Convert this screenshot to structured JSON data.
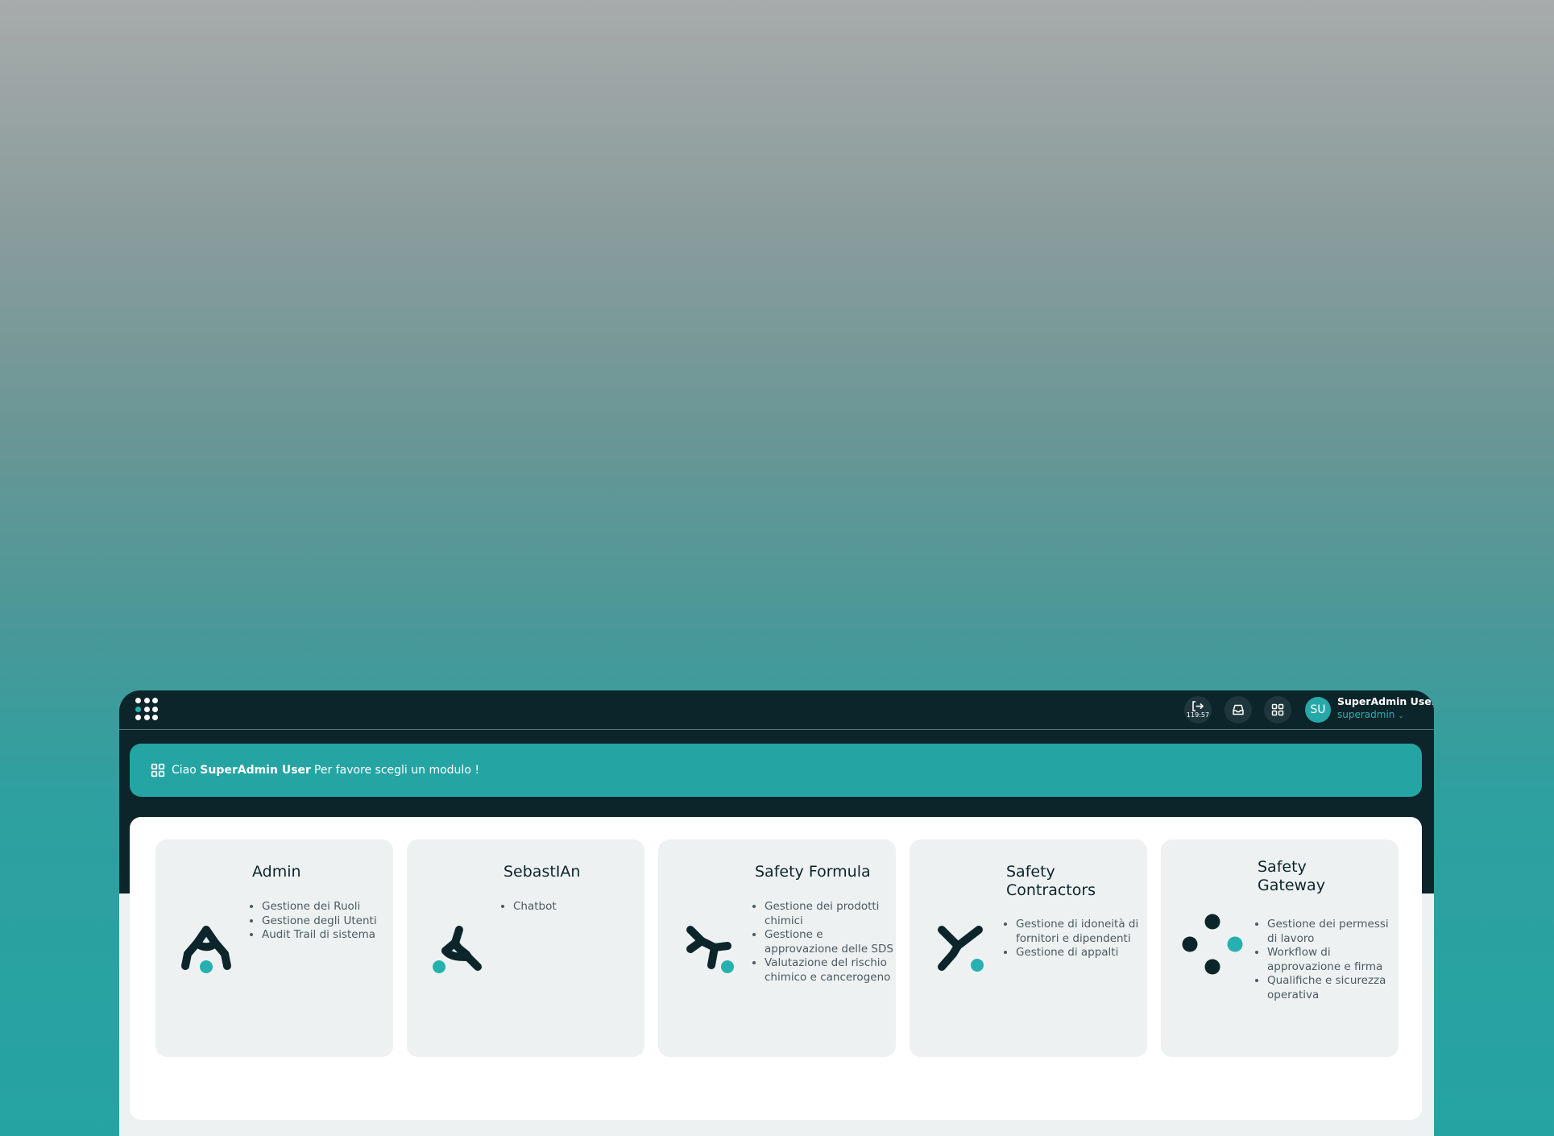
{
  "topbar": {
    "session_timer": "119:57",
    "user_initials": "SU",
    "user_name": "SuperAdmin User",
    "user_role": "superadmin",
    "role_chevron": "⌄"
  },
  "welcome": {
    "prefix": "Ciao",
    "name": "SuperAdmin User",
    "suffix": "Per favore scegli un modulo !"
  },
  "modules": [
    {
      "title": "Admin",
      "items": [
        "Gestione dei Ruoli",
        "Gestione degli Utenti",
        "Audit Trail di sistema"
      ]
    },
    {
      "title": "SebastIAn",
      "items": [
        "Chatbot"
      ]
    },
    {
      "title": "Safety Formula",
      "items": [
        "Gestione dei prodotti chimici",
        "Gestione e approvazione delle SDS",
        "Valutazione del rischio chimico e cancerogeno"
      ]
    },
    {
      "title": "Safety Contractors",
      "items": [
        "Gestione di idoneità di fornitori e dipendenti",
        "Gestione di appalti"
      ]
    },
    {
      "title": "Safety Gateway",
      "items": [
        "Gestione dei permessi di lavoro",
        "Workflow di approvazione e firma",
        "Qualifiche e sicurezza operativa"
      ]
    }
  ],
  "colors": {
    "dark": "#0c252b",
    "accent": "#25a4a4",
    "card_bg": "#eef1f2"
  },
  "icons": {
    "apps": "apps-grid-icon",
    "session": "logout-icon",
    "inbox": "inbox-icon",
    "modules": "modules-grid-icon"
  }
}
